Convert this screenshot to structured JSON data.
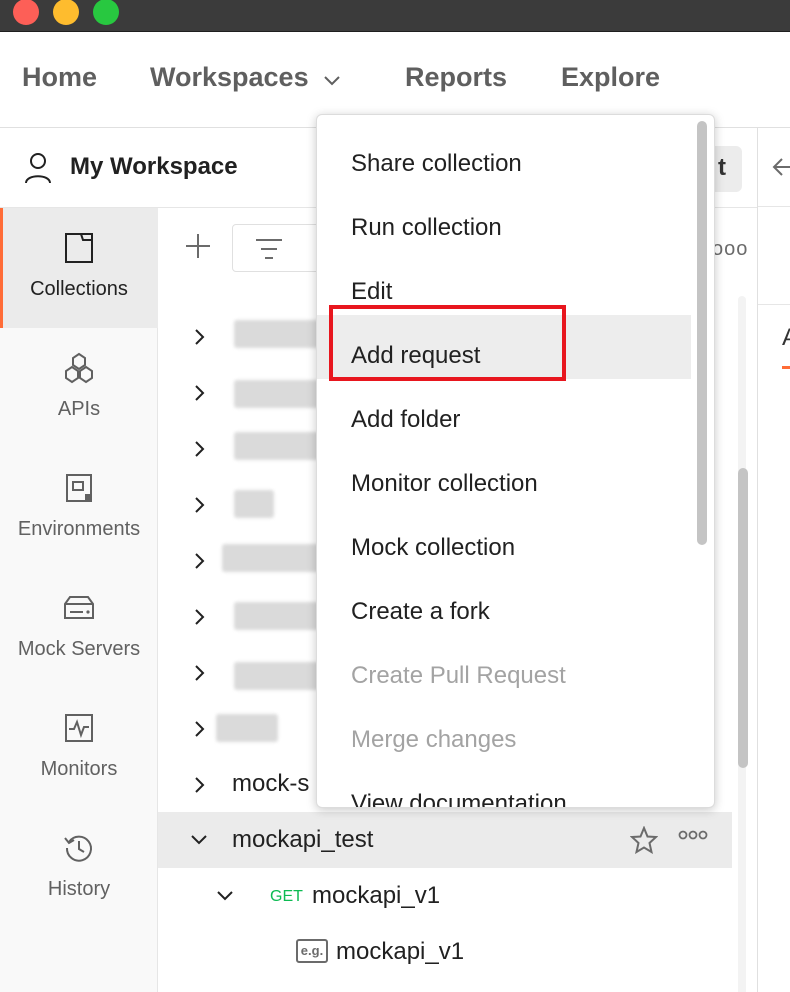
{
  "window": {
    "controls": [
      "close",
      "minimize",
      "maximize"
    ]
  },
  "nav": {
    "home": "Home",
    "workspaces": "Workspaces",
    "reports": "Reports",
    "explore": "Explore"
  },
  "workspace": {
    "title": "My Workspace",
    "button_partial": "t"
  },
  "right_pane": {
    "tab_partial": "A"
  },
  "sidebar": {
    "items": [
      {
        "label": "Collections",
        "icon": "collections-icon",
        "active": true
      },
      {
        "label": "APIs",
        "icon": "apis-icon"
      },
      {
        "label": "Environments",
        "icon": "environments-icon"
      },
      {
        "label": "Mock Servers",
        "icon": "mock-servers-icon"
      },
      {
        "label": "Monitors",
        "icon": "monitors-icon"
      },
      {
        "label": "History",
        "icon": "history-icon"
      }
    ]
  },
  "collections": {
    "more": "ooo",
    "partial_row": "mock-s",
    "selected": {
      "name": "mockapi_test"
    },
    "request": {
      "method": "GET",
      "name": "mockapi_v1"
    },
    "example": {
      "badge": "e.g.",
      "name": "mockapi_v1"
    }
  },
  "menu": {
    "items": [
      {
        "label": "Share collection"
      },
      {
        "label": "Run collection"
      },
      {
        "label": "Edit"
      },
      {
        "label": "Add request",
        "highlighted": true
      },
      {
        "label": "Add folder"
      },
      {
        "label": "Monitor collection"
      },
      {
        "label": "Mock collection"
      },
      {
        "label": "Create a fork"
      },
      {
        "label": "Create Pull Request",
        "disabled": true
      },
      {
        "label": "Merge changes",
        "disabled": true
      },
      {
        "label": "View documentation"
      }
    ]
  },
  "colors": {
    "accent": "#ff6c37",
    "get_method": "#0cbb52",
    "highlight_box": "#e8161e"
  }
}
